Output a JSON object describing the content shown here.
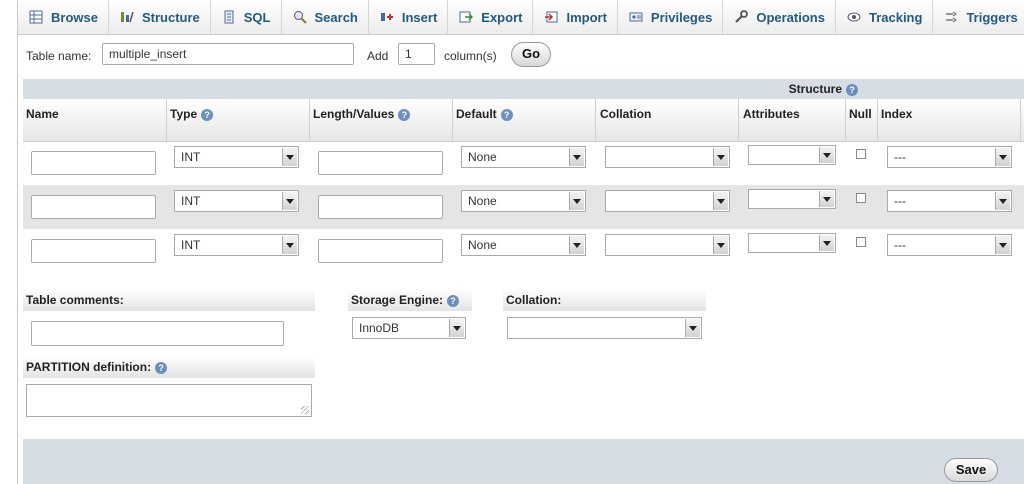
{
  "tabs": [
    {
      "label": "Browse",
      "icon": "browse-icon"
    },
    {
      "label": "Structure",
      "icon": "structure-icon"
    },
    {
      "label": "SQL",
      "icon": "sql-icon"
    },
    {
      "label": "Search",
      "icon": "search-icon"
    },
    {
      "label": "Insert",
      "icon": "insert-icon"
    },
    {
      "label": "Export",
      "icon": "export-icon"
    },
    {
      "label": "Import",
      "icon": "import-icon"
    },
    {
      "label": "Privileges",
      "icon": "privileges-icon"
    },
    {
      "label": "Operations",
      "icon": "operations-icon"
    },
    {
      "label": "Tracking",
      "icon": "tracking-icon"
    },
    {
      "label": "Triggers",
      "icon": "triggers-icon"
    }
  ],
  "table_name": {
    "label": "Table name:",
    "value": "multiple_insert"
  },
  "add_columns": {
    "add_label": "Add",
    "count": "1",
    "unit_label": "column(s)",
    "go_label": "Go"
  },
  "structure": {
    "title": "Structure",
    "columns": [
      "Name",
      "Type",
      "Length/Values",
      "Default",
      "Collation",
      "Attributes",
      "Null",
      "Index"
    ],
    "rows": [
      {
        "name": "",
        "type": "INT",
        "length": "",
        "default": "None",
        "collation": "",
        "attributes": "",
        "null": false,
        "index": "---"
      },
      {
        "name": "",
        "type": "INT",
        "length": "",
        "default": "None",
        "collation": "",
        "attributes": "",
        "null": false,
        "index": "---"
      },
      {
        "name": "",
        "type": "INT",
        "length": "",
        "default": "None",
        "collation": "",
        "attributes": "",
        "null": false,
        "index": "---"
      }
    ]
  },
  "table_comments": {
    "label": "Table comments:",
    "value": ""
  },
  "storage_engine": {
    "label": "Storage Engine:",
    "value": "InnoDB"
  },
  "table_collation": {
    "label": "Collation:",
    "value": ""
  },
  "partition": {
    "label": "PARTITION definition:",
    "value": ""
  },
  "save_label": "Save",
  "colors": {
    "link": "#235a81",
    "bar": "#d6dde5",
    "alt_row": "#e5e5e5"
  }
}
